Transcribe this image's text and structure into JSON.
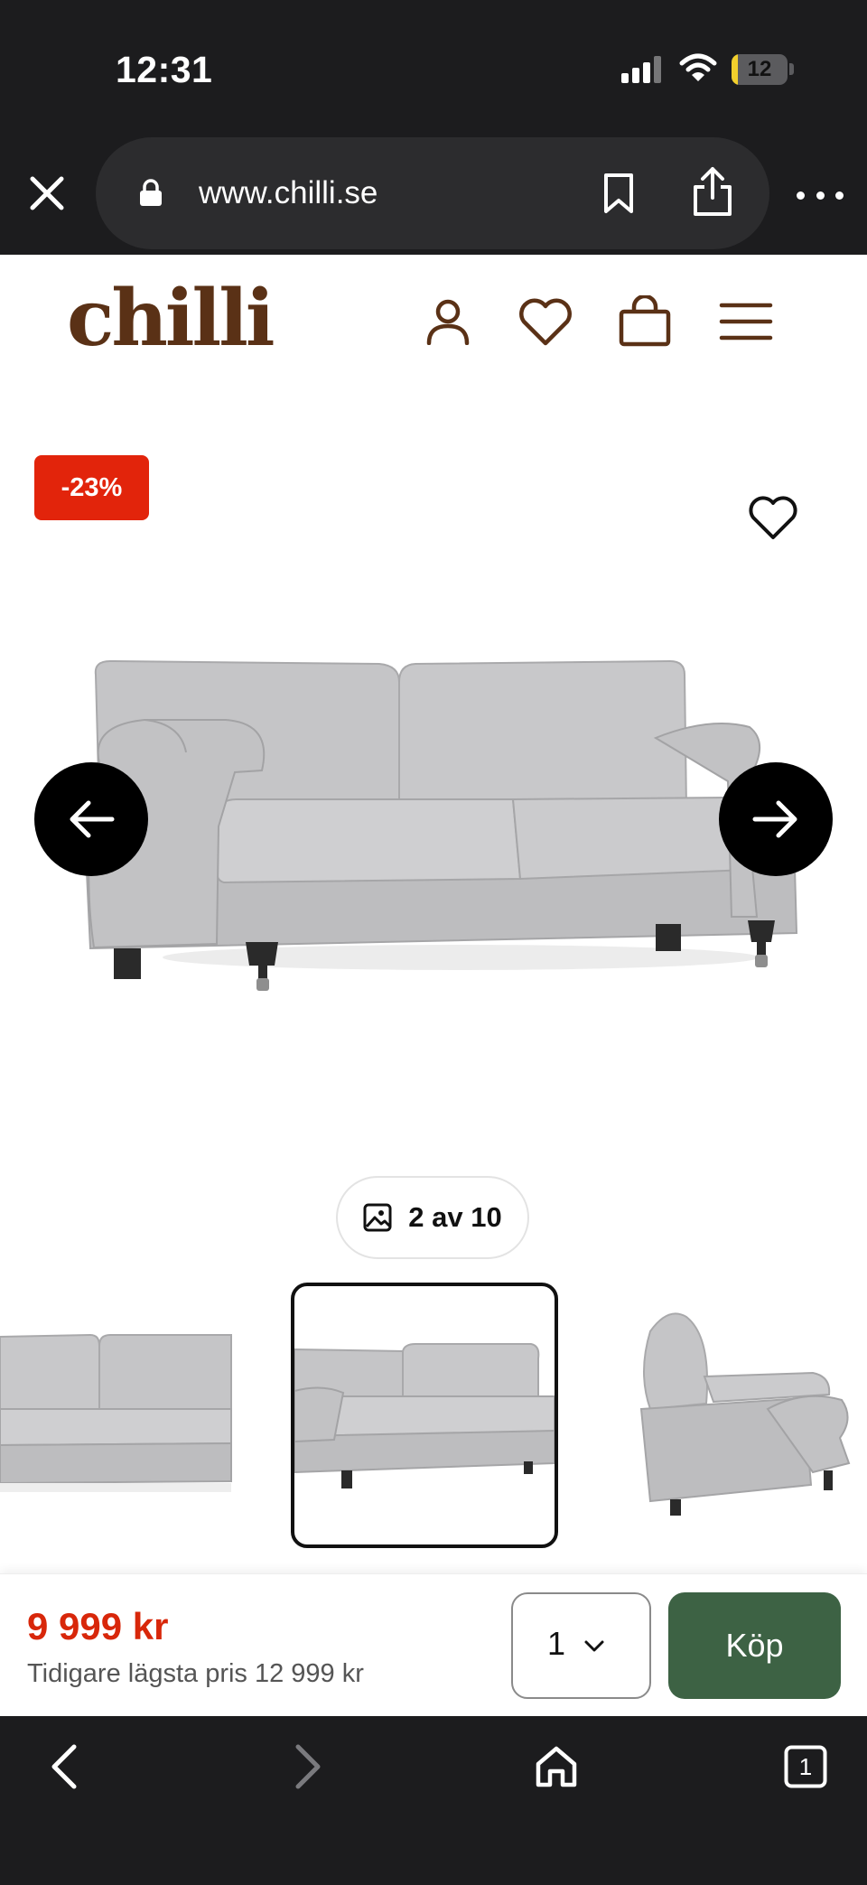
{
  "status_bar": {
    "time": "12:31",
    "battery_level": "12",
    "battery_fraction": 0.12
  },
  "browser": {
    "url": "www.chilli.se"
  },
  "site": {
    "logo": "chilli"
  },
  "product": {
    "discount": "-23%",
    "image_counter": "2 av 10",
    "price": "9 999 kr",
    "previous_price": "Tidigare lägsta pris 12 999 kr",
    "quantity": "1",
    "buy_label": "Köp"
  },
  "colors": {
    "brand": "#5a3116",
    "discount": "#e2240b",
    "price": "#d8270a",
    "buy_button": "#3d6244",
    "chrome": "#1c1c1e"
  },
  "icons": {
    "browser": [
      "close-icon",
      "lock-icon",
      "bookmark-icon",
      "share-icon",
      "more-icon"
    ],
    "header": [
      "account-icon",
      "wishlist-icon",
      "cart-icon",
      "menu-icon"
    ],
    "gallery": [
      "heart-icon",
      "arrow-left-icon",
      "arrow-right-icon",
      "image-icon"
    ],
    "toolbar": [
      "back-icon",
      "forward-icon",
      "home-icon",
      "tabs-icon"
    ]
  }
}
